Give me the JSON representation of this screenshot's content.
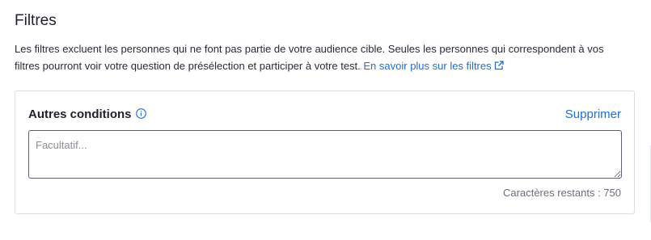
{
  "section": {
    "title": "Filtres",
    "description": "Les filtres excluent les personnes qui ne font pas partie de votre audience cible. Seules les personnes qui correspondent à vos filtres pourront voir votre question de présélection et participer à votre test. ",
    "learn_more_link": "En savoir plus sur les filtres"
  },
  "condition_card": {
    "title": "Autres conditions",
    "delete_label": "Supprimer",
    "input": {
      "value": "",
      "placeholder": "Facultatif..."
    },
    "remaining_characters": "Caractères restants : 750"
  },
  "colors": {
    "link": "#1f6fd1",
    "text": "#1f1f2e",
    "border": "#dcdde3"
  },
  "icons": {
    "link_icon": "external-link-icon",
    "info_icon": "info-icon"
  }
}
